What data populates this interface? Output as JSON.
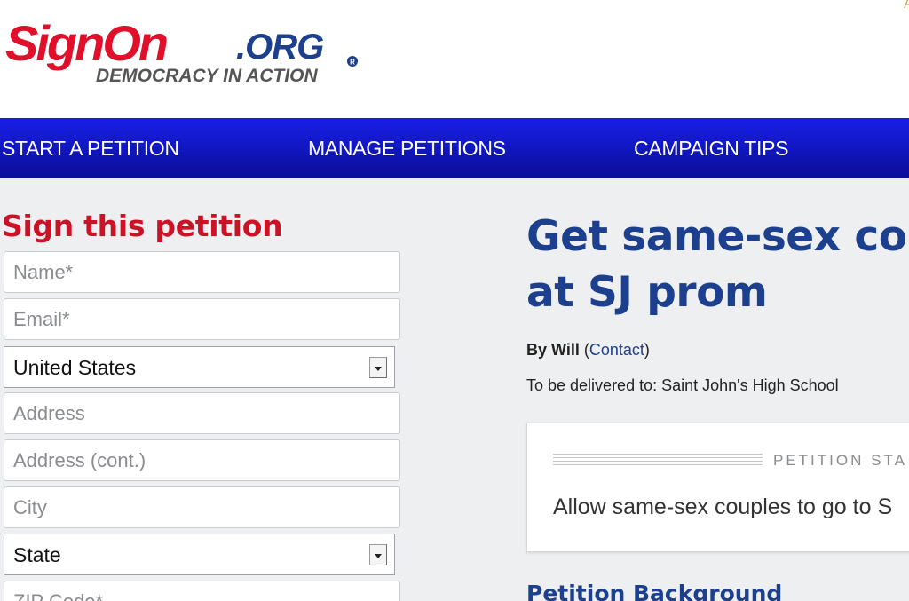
{
  "header": {
    "logo": {
      "brand_main": "SignOn",
      "brand_suffix": ".ORG",
      "tagline": "DEMOCRACY IN ACTION",
      "registered_mark": "R",
      "brand_color": "#e0102a",
      "suffix_color": "#1c3f8e",
      "tagline_color": "#555555"
    },
    "corner_text": "A"
  },
  "nav": {
    "items": [
      {
        "label": "START A PETITION"
      },
      {
        "label": "MANAGE PETITIONS"
      },
      {
        "label": "CAMPAIGN TIPS"
      }
    ],
    "background_color": "#1118c4"
  },
  "sign_form": {
    "heading": "Sign this petition",
    "heading_color": "#cc1226",
    "name_placeholder": "Name*",
    "email_placeholder": "Email*",
    "country_value": "United States",
    "address_placeholder": "Address",
    "address2_placeholder": "Address (cont.)",
    "city_placeholder": "City",
    "state_value": "State",
    "zip_placeholder": "ZIP Code*"
  },
  "petition": {
    "title": "Get same-sex couples to go at SJ prom",
    "title_visible": "Get same-sex co",
    "title_line2": "at SJ prom",
    "by_prefix": "By ",
    "author": "Will",
    "contact_open": " (",
    "contact_label": "Contact",
    "contact_close": ")",
    "delivered_to": "To be delivered to: Saint John's High School",
    "statement_label": "PETITION STA",
    "statement_text": "Allow same-sex couples to go to S",
    "background_heading": "Petition Background",
    "accent_color": "#1c3f8e"
  }
}
